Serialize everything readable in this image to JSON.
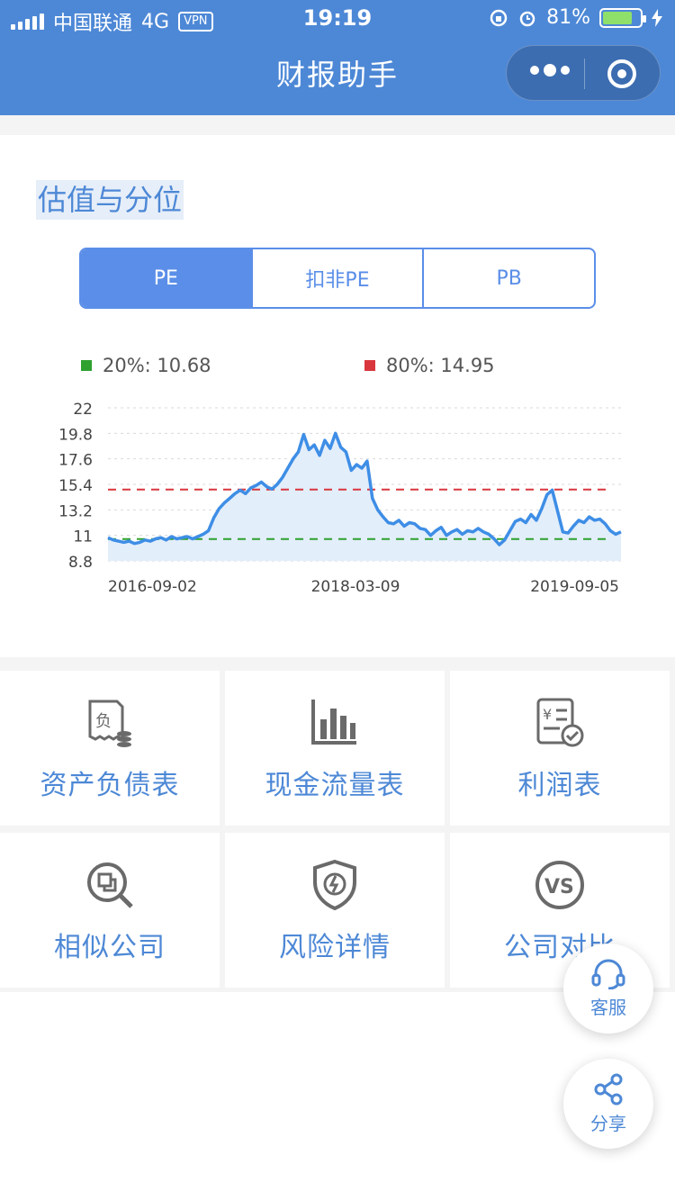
{
  "status": {
    "carrier": "中国联通",
    "network": "4G",
    "vpn": "VPN",
    "time": "19:19",
    "battery": "81%"
  },
  "nav": {
    "title": "财报助手"
  },
  "valuation": {
    "title": "估值与分位",
    "tabs": [
      {
        "label": "PE",
        "active": true
      },
      {
        "label": "扣非PE",
        "active": false
      },
      {
        "label": "PB",
        "active": false
      }
    ],
    "legend": [
      {
        "label": "20%: 10.68",
        "color": "#2ea12e"
      },
      {
        "label": "80%: 14.95",
        "color": "#d9363e"
      }
    ]
  },
  "chart_data": {
    "type": "area",
    "x_ticks": [
      "2016-09-02",
      "2018-03-09",
      "2019-09-05"
    ],
    "y_ticks": [
      "22",
      "19.8",
      "17.6",
      "15.4",
      "13.2",
      "11",
      "8.8"
    ],
    "ylim": [
      8.8,
      22
    ],
    "reference_lines": [
      {
        "name": "20%",
        "value": 10.68,
        "color": "#2ea12e"
      },
      {
        "name": "80%",
        "value": 14.95,
        "color": "#d9363e"
      }
    ],
    "line_color": "#3e8ee6",
    "series": [
      {
        "values": [
          10.8,
          10.6,
          10.5,
          10.4,
          10.5,
          10.3,
          10.4,
          10.6,
          10.5,
          10.7,
          10.8,
          10.6,
          10.9,
          10.7,
          10.8,
          10.9,
          10.7,
          10.9,
          11.1,
          11.4,
          12.5,
          13.3,
          13.8,
          14.2,
          14.6,
          14.9,
          14.6,
          15.1,
          15.3,
          15.6,
          15.2,
          15.0,
          15.4,
          16.0,
          16.8,
          17.6,
          18.2,
          19.7,
          18.4,
          18.8,
          17.9,
          19.2,
          18.5,
          19.8,
          18.6,
          18.2,
          16.6,
          17.1,
          16.8,
          17.4,
          14.2,
          13.2,
          12.6,
          12.1,
          12.0,
          12.3,
          11.8,
          12.1,
          12.0,
          11.6,
          11.5,
          11.0,
          11.4,
          11.7,
          11.0,
          11.3,
          11.5,
          11.1,
          11.4,
          11.3,
          11.6,
          11.3,
          11.1,
          10.7,
          10.2,
          10.6,
          11.4,
          12.2,
          12.4,
          12.1,
          12.8,
          12.3,
          13.3,
          14.5,
          14.9,
          13.1,
          11.3,
          11.2,
          11.8,
          12.3,
          12.1,
          12.6,
          12.3,
          12.4,
          12.0,
          11.4,
          11.1,
          11.3
        ]
      }
    ]
  },
  "grid": [
    {
      "label": "资产负债表",
      "icon": "balance-sheet-icon"
    },
    {
      "label": "现金流量表",
      "icon": "bar-chart-icon"
    },
    {
      "label": "利润表",
      "icon": "profit-statement-icon"
    },
    {
      "label": "相似公司",
      "icon": "search-company-icon"
    },
    {
      "label": "风险详情",
      "icon": "shield-icon"
    },
    {
      "label": "公司对比",
      "icon": "vs-icon"
    }
  ],
  "fab": {
    "service": "客服",
    "share": "分享"
  }
}
